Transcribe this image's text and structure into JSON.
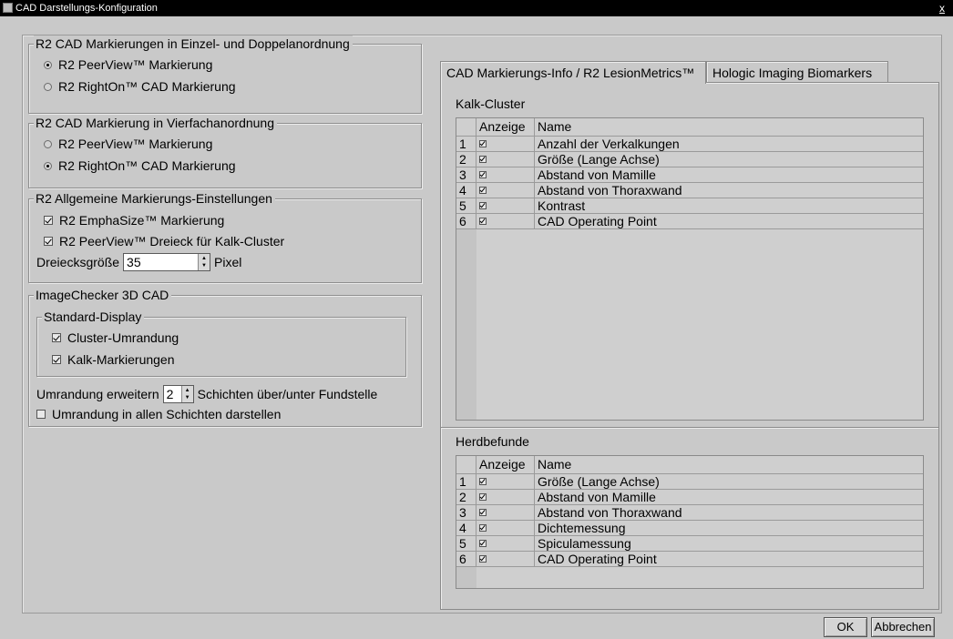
{
  "window": {
    "title": "CAD Darstellungs-Konfiguration",
    "close_label": "x"
  },
  "left": {
    "group1": {
      "title": "R2 CAD Markierungen in Einzel- und Doppelanordnung",
      "option1": "R2 PeerView™ Markierung",
      "option2": "R2 RightOn™ CAD Markierung",
      "selected": "option1"
    },
    "group2": {
      "title": "R2 CAD Markierung in Vierfachanordnung",
      "option1": "R2 PeerView™ Markierung",
      "option2": "R2 RightOn™ CAD Markierung",
      "selected": "option2"
    },
    "group3": {
      "title": "R2 Allgemeine Markierungs-Einstellungen",
      "check1": "R2 EmphaSize™ Markierung",
      "check2": "R2 PeerView™ Dreieck für Kalk-Cluster",
      "triangle_label": "Dreiecksgröße",
      "triangle_value": "35",
      "triangle_unit": "Pixel"
    },
    "group4": {
      "title": "ImageChecker 3D CAD",
      "sub_title": "Standard-Display",
      "check1": "Cluster-Umrandung",
      "check2": "Kalk-Markierungen",
      "extend_prefix": "Umrandung erweitern",
      "extend_value": "2",
      "extend_suffix": "Schichten über/unter Fundstelle",
      "all_slices": "Umrandung in allen Schichten darstellen"
    }
  },
  "tabs": [
    {
      "label": "CAD Markierungs-Info / R2 LesionMetrics™",
      "active": true
    },
    {
      "label": "Hologic Imaging Biomarkers",
      "active": false
    }
  ],
  "calc": {
    "title": "Kalk-Cluster",
    "header_show": "Anzeige",
    "header_name": "Name",
    "rows": [
      {
        "num": "1",
        "name": "Anzahl der Verkalkungen"
      },
      {
        "num": "2",
        "name": "Größe (Lange Achse)"
      },
      {
        "num": "3",
        "name": "Abstand von Mamille"
      },
      {
        "num": "4",
        "name": "Abstand von Thoraxwand"
      },
      {
        "num": "5",
        "name": "Kontrast"
      },
      {
        "num": "6",
        "name": "CAD Operating Point"
      }
    ]
  },
  "mass": {
    "title": "Herdbefunde",
    "header_show": "Anzeige",
    "header_name": "Name",
    "rows": [
      {
        "num": "1",
        "name": "Größe (Lange Achse)"
      },
      {
        "num": "2",
        "name": "Abstand von Mamille"
      },
      {
        "num": "3",
        "name": "Abstand von Thoraxwand"
      },
      {
        "num": "4",
        "name": "Dichtemessung"
      },
      {
        "num": "5",
        "name": "Spiculamessung"
      },
      {
        "num": "6",
        "name": "CAD Operating Point"
      }
    ]
  },
  "buttons": {
    "ok": "OK",
    "cancel": "Abbrechen"
  }
}
